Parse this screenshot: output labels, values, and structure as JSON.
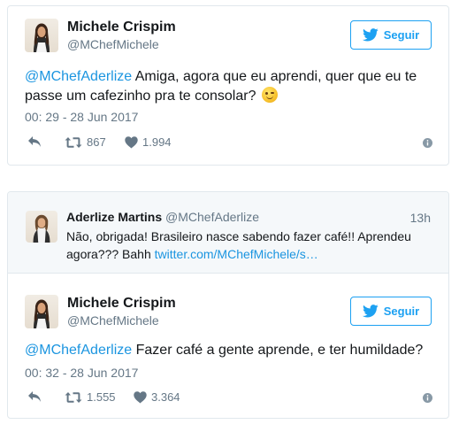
{
  "tweet1": {
    "name": "Michele Crispim",
    "handle": "@MChefMichele",
    "follow_label": "Seguir",
    "mention": "@MChefAderlize",
    "text": " Amiga, agora que eu aprendi, quer que eu te passe um cafezinho pra te consolar? ",
    "emoji": "winking-face",
    "timestamp": "00: 29 - 28 Jun 2017",
    "retweets": "867",
    "likes": "1.994"
  },
  "quoted": {
    "name": "Aderlize Martins",
    "handle": "@MChefAderlize",
    "time": "13h",
    "text": "Não, obrigada! Brasileiro nasce sabendo fazer café!! Aprendeu agora??? Bahh ",
    "link": "twitter.com/MChefMichele/s…"
  },
  "tweet2": {
    "name": "Michele Crispim",
    "handle": "@MChefMichele",
    "follow_label": "Seguir",
    "mention": "@MChefAderlize",
    "text": " Fazer café a gente aprende, e ter humildade?",
    "timestamp": "00: 32 - 28 Jun 2017",
    "retweets": "1.555",
    "likes": "3.364"
  },
  "colors": {
    "accent": "#1da1f2",
    "link": "#1b95e0",
    "muted": "#657786",
    "border": "#e1e8ed",
    "quote_bg": "#f5f8fa"
  },
  "icons": [
    "avatar",
    "twitter-bird-icon",
    "reply-icon",
    "retweet-icon",
    "heart-icon",
    "info-icon"
  ]
}
